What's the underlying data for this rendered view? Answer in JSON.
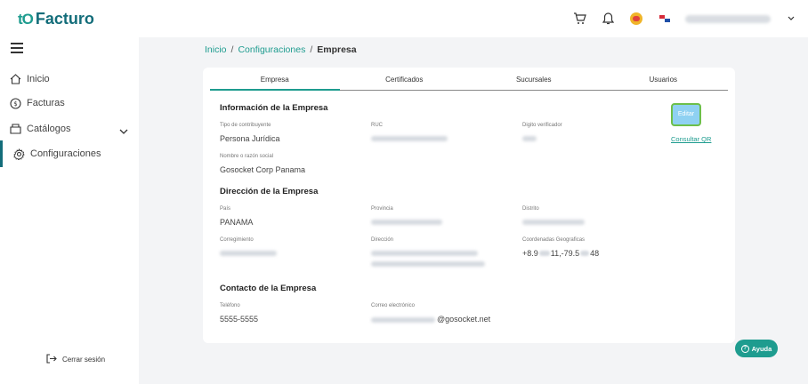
{
  "app": {
    "logo_mark": "tO",
    "logo_text": "Facturo"
  },
  "sidebar": {
    "items": [
      {
        "label": "Inicio",
        "icon": "home-icon"
      },
      {
        "label": "Facturas",
        "icon": "dollar-circle-icon"
      },
      {
        "label": "Catálogos",
        "icon": "catalog-icon"
      },
      {
        "label": "Configuraciones",
        "icon": "gear-icon"
      }
    ],
    "logout_label": "Cerrar sesión"
  },
  "breadcrumb": {
    "home": "Inicio",
    "section": "Configuraciones",
    "current": "Empresa",
    "separator": "/"
  },
  "tabs": [
    "Empresa",
    "Certificados",
    "Sucursales",
    "Usuarios"
  ],
  "company_info": {
    "title": "Información de la Empresa",
    "taxpayer_type_label": "Tipo de contribuyente",
    "taxpayer_type_value": "Persona Jurídica",
    "ruc_label": "RUC",
    "verifier_label": "Digito verificador",
    "name_label": "Nombre o razón social",
    "name_value": "Gosocket Corp Panama"
  },
  "address": {
    "title": "Dirección de la Empresa",
    "country_label": "País",
    "country_value": "PANAMA",
    "province_label": "Provincia",
    "district_label": "Distrito",
    "township_label": "Corregimiento",
    "address_label": "Dirección",
    "coords_label": "Coordenadas Geograficas",
    "coords_part1": "+8.9",
    "coords_part2": "11,-79.5",
    "coords_part3": "48"
  },
  "contact": {
    "title": "Contacto de la Empresa",
    "phone_label": "Teléfono",
    "phone_value": "5555-5555",
    "email_label": "Correo electrónico",
    "email_domain": "@gosocket.net"
  },
  "actions": {
    "edit_label": "Editar",
    "qr_label": "Consultar QR"
  },
  "help_label": "Ayuda",
  "colors": {
    "brand": "#1e9c8f",
    "brand_dark": "#136d7a",
    "edit_bg": "#8fd1f2",
    "edit_border": "#6dbf4a",
    "page_bg": "#f3f4f6"
  }
}
